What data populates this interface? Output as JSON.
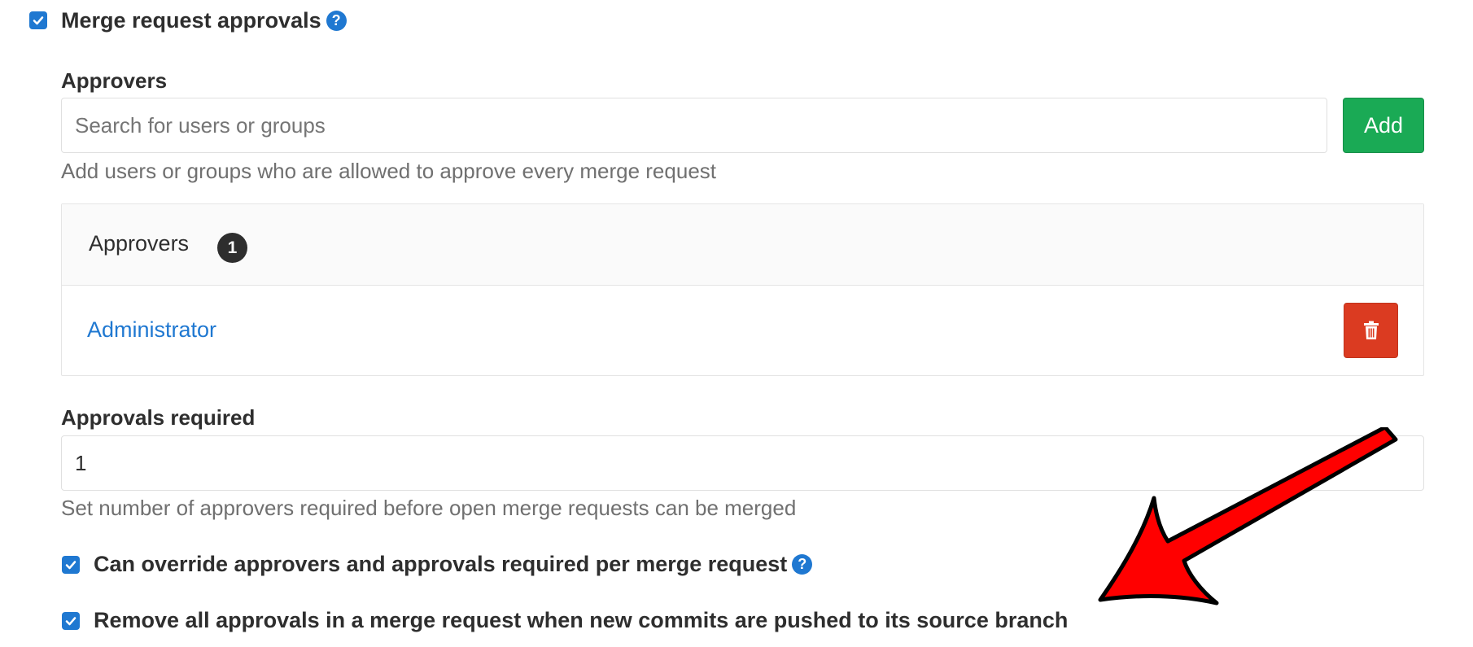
{
  "main": {
    "merge_approvals": {
      "label": "Merge request approvals",
      "checked": true,
      "help_icon": "question-circle-icon"
    },
    "approvers_section": {
      "label": "Approvers",
      "search_placeholder": "Search for users or groups",
      "add_button": "Add",
      "help_text": "Add users or groups who are allowed to approve every merge request"
    },
    "approvers_list": {
      "title": "Approvers",
      "count": "1",
      "items": [
        {
          "name": "Administrator",
          "action_icon": "trash-icon"
        }
      ]
    },
    "approvals_required": {
      "label": "Approvals required",
      "value": "1",
      "help_text": "Set number of approvers required before open merge requests can be merged"
    },
    "override_option": {
      "label": "Can override approvers and approvals required per merge request",
      "checked": true,
      "help_icon": "question-circle-icon"
    },
    "remove_option": {
      "label": "Remove all approvals in a merge request when new commits are pushed to its source branch",
      "checked": true
    }
  },
  "colors": {
    "checkbox": "#1f78d1",
    "add_button": "#1aaa55",
    "delete_button": "#db3b21",
    "link": "#1f78d1",
    "annotation_arrow": "#ff0000"
  },
  "annotation": {
    "type": "arrow",
    "icon": "red-arrow"
  }
}
